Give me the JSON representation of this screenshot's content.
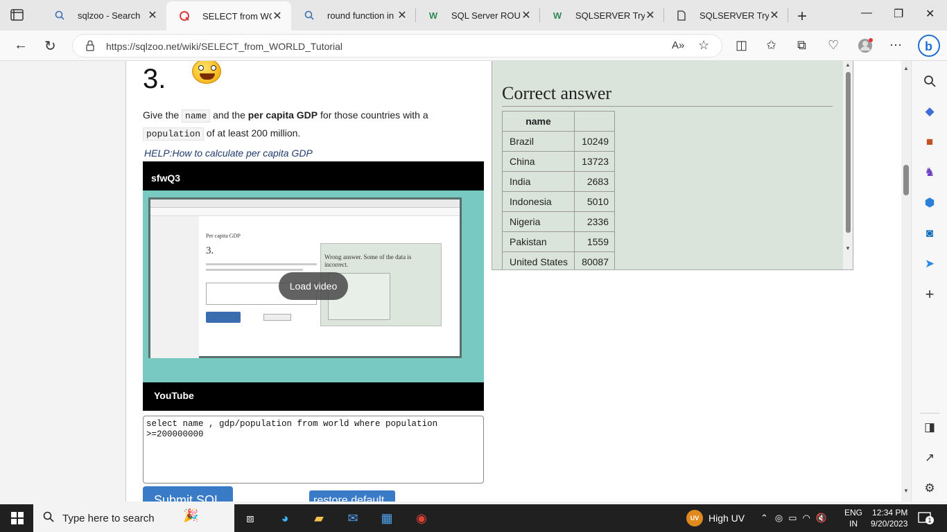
{
  "tabs": [
    {
      "title": "sqlzoo - Search",
      "icon": "search-icon",
      "active": false
    },
    {
      "title": "SELECT from WORLD Tutorial",
      "icon": "sqlzoo-icon",
      "active": true
    },
    {
      "title": "round function in sql",
      "icon": "search-icon",
      "active": false
    },
    {
      "title": "SQL Server ROUND",
      "icon": "w3schools-icon",
      "active": false
    },
    {
      "title": "SQLSERVER Tryit",
      "icon": "w3schools-icon",
      "active": false
    },
    {
      "title": "SQLSERVER Tryit",
      "icon": "page-icon",
      "active": false
    }
  ],
  "address": {
    "url": "https://sqlzoo.net/wiki/SELECT_from_WORLD_Tutorial"
  },
  "question": {
    "number": "3.",
    "text_pre": "Give the ",
    "code_name": "name",
    "text_mid": " and the ",
    "text_bold": "per capita GDP",
    "text_post": " for those countries with a ",
    "code_population": "population",
    "text_end": " of at least 200 million.",
    "help_link": "HELP:How to calculate per capita GDP"
  },
  "video": {
    "title": "sfwQ3",
    "load_label": "Load video",
    "footer": "YouTube",
    "preview": {
      "page_title": "Per capita GDP",
      "number": "3.",
      "wrong_text": "Wrong answer. Some of the data is incorrect."
    }
  },
  "sql": {
    "query": "select name , gdp/population from world where population\n>=200000000"
  },
  "buttons": {
    "submit": "Submit SQL",
    "restore": "restore default"
  },
  "answer": {
    "heading": "Correct answer",
    "columns": [
      "name",
      ""
    ],
    "rows": [
      {
        "name": "Brazil",
        "value": "10249"
      },
      {
        "name": "China",
        "value": "13723"
      },
      {
        "name": "India",
        "value": "2683"
      },
      {
        "name": "Indonesia",
        "value": "5010"
      },
      {
        "name": "Nigeria",
        "value": "2336"
      },
      {
        "name": "Pakistan",
        "value": "1559"
      },
      {
        "name": "United States",
        "value": "80087"
      }
    ]
  },
  "taskbar": {
    "search_placeholder": "Type here to search",
    "weather_badge": "UV",
    "weather": "High UV",
    "lang1": "ENG",
    "lang2": "IN",
    "time": "12:34 PM",
    "date": "9/20/2023",
    "notif_count": "1"
  },
  "colors": {
    "accent": "#3a7bc8",
    "answer_bg": "#dbe4db",
    "video_bg": "#77c9c1"
  }
}
